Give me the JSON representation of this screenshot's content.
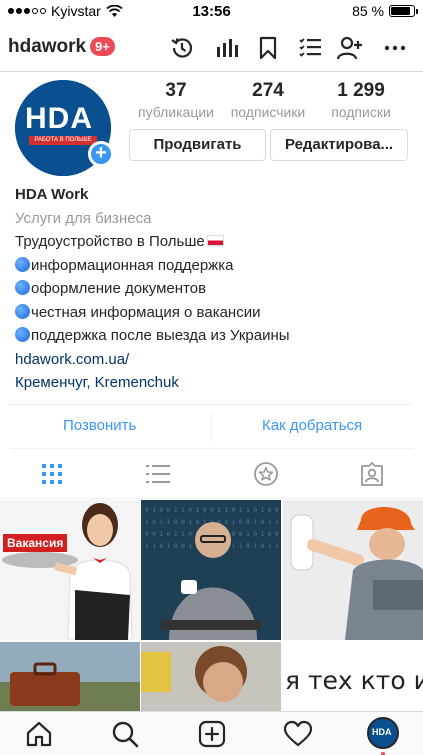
{
  "status_bar": {
    "carrier": "Kyivstar",
    "time": "13:56",
    "battery_text": "85 %",
    "battery_level": 0.85
  },
  "header": {
    "username": "hdawork",
    "notification_badge": "9+"
  },
  "profile": {
    "avatar_logo_text": "HDA",
    "avatar_strip_text": "РАБОТА В ПОЛЬШЕ",
    "stats": [
      {
        "value": "37",
        "label": "публикации"
      },
      {
        "value": "274",
        "label": "подписчики"
      },
      {
        "value": "1 299",
        "label": "подписки"
      }
    ],
    "promote_button": "Продвигать",
    "edit_button": "Редактирова..."
  },
  "bio": {
    "name": "HDA Work",
    "category": "Услуги для бизнеса",
    "line1": "Трудоустройство в Польше",
    "bullets": [
      "информационная поддержка",
      "оформление документов",
      "честная информация о вакансии",
      "поддержка после выезда из Украины"
    ],
    "website": "hdawork.com.ua/",
    "location": "Кременчуг, Kremenchuk"
  },
  "contact": {
    "call": "Позвонить",
    "directions": "Как добраться"
  },
  "grid": {
    "post1_label": "Вакансия",
    "post6_text": "я тех кто и"
  },
  "bottom_nav": {
    "avatar_text": "HDA"
  },
  "colors": {
    "accent": "#3897f0",
    "badge": "#ed4956",
    "link": "#003569"
  }
}
